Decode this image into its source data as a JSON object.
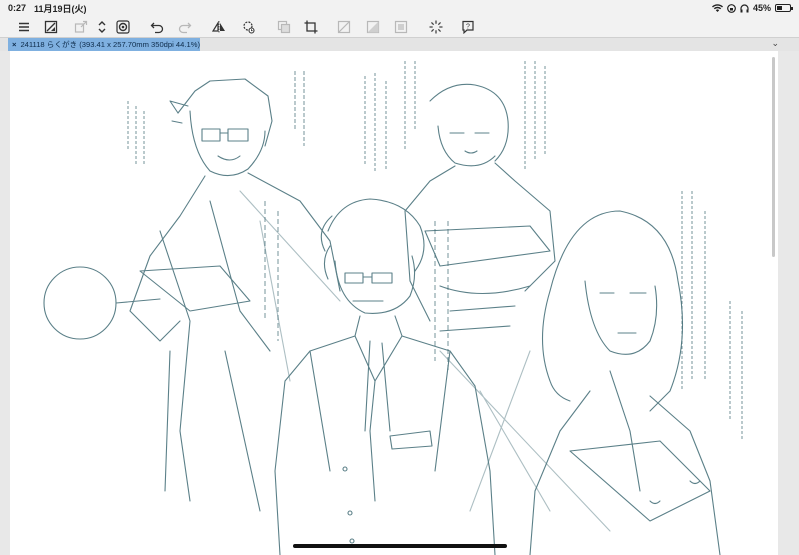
{
  "status_bar": {
    "time": "0:27",
    "date": "11月19日(火)",
    "battery": "45%",
    "battery_level": 0.45
  },
  "toolbar": {
    "icons": [
      "menu-icon",
      "clear-layer-icon",
      "transform-icon",
      "snap-icon",
      "undo-icon",
      "redo-icon",
      "flip-horizontal-icon",
      "rotate-icon",
      "copy-icon",
      "crop-icon",
      "fill-icon",
      "gradient-icon",
      "select-icon",
      "loading-icon",
      "help-icon"
    ]
  },
  "tab": {
    "close": "×",
    "title": "241118 らくがき (393.41 x 257.70mm 350dpi 44.1%)"
  },
  "tab_menu": "⌄",
  "colors": {
    "sketch": "#3f6a74",
    "tab_active": "#7fb0e0",
    "toolbar_bg": "#f2f2f2"
  }
}
